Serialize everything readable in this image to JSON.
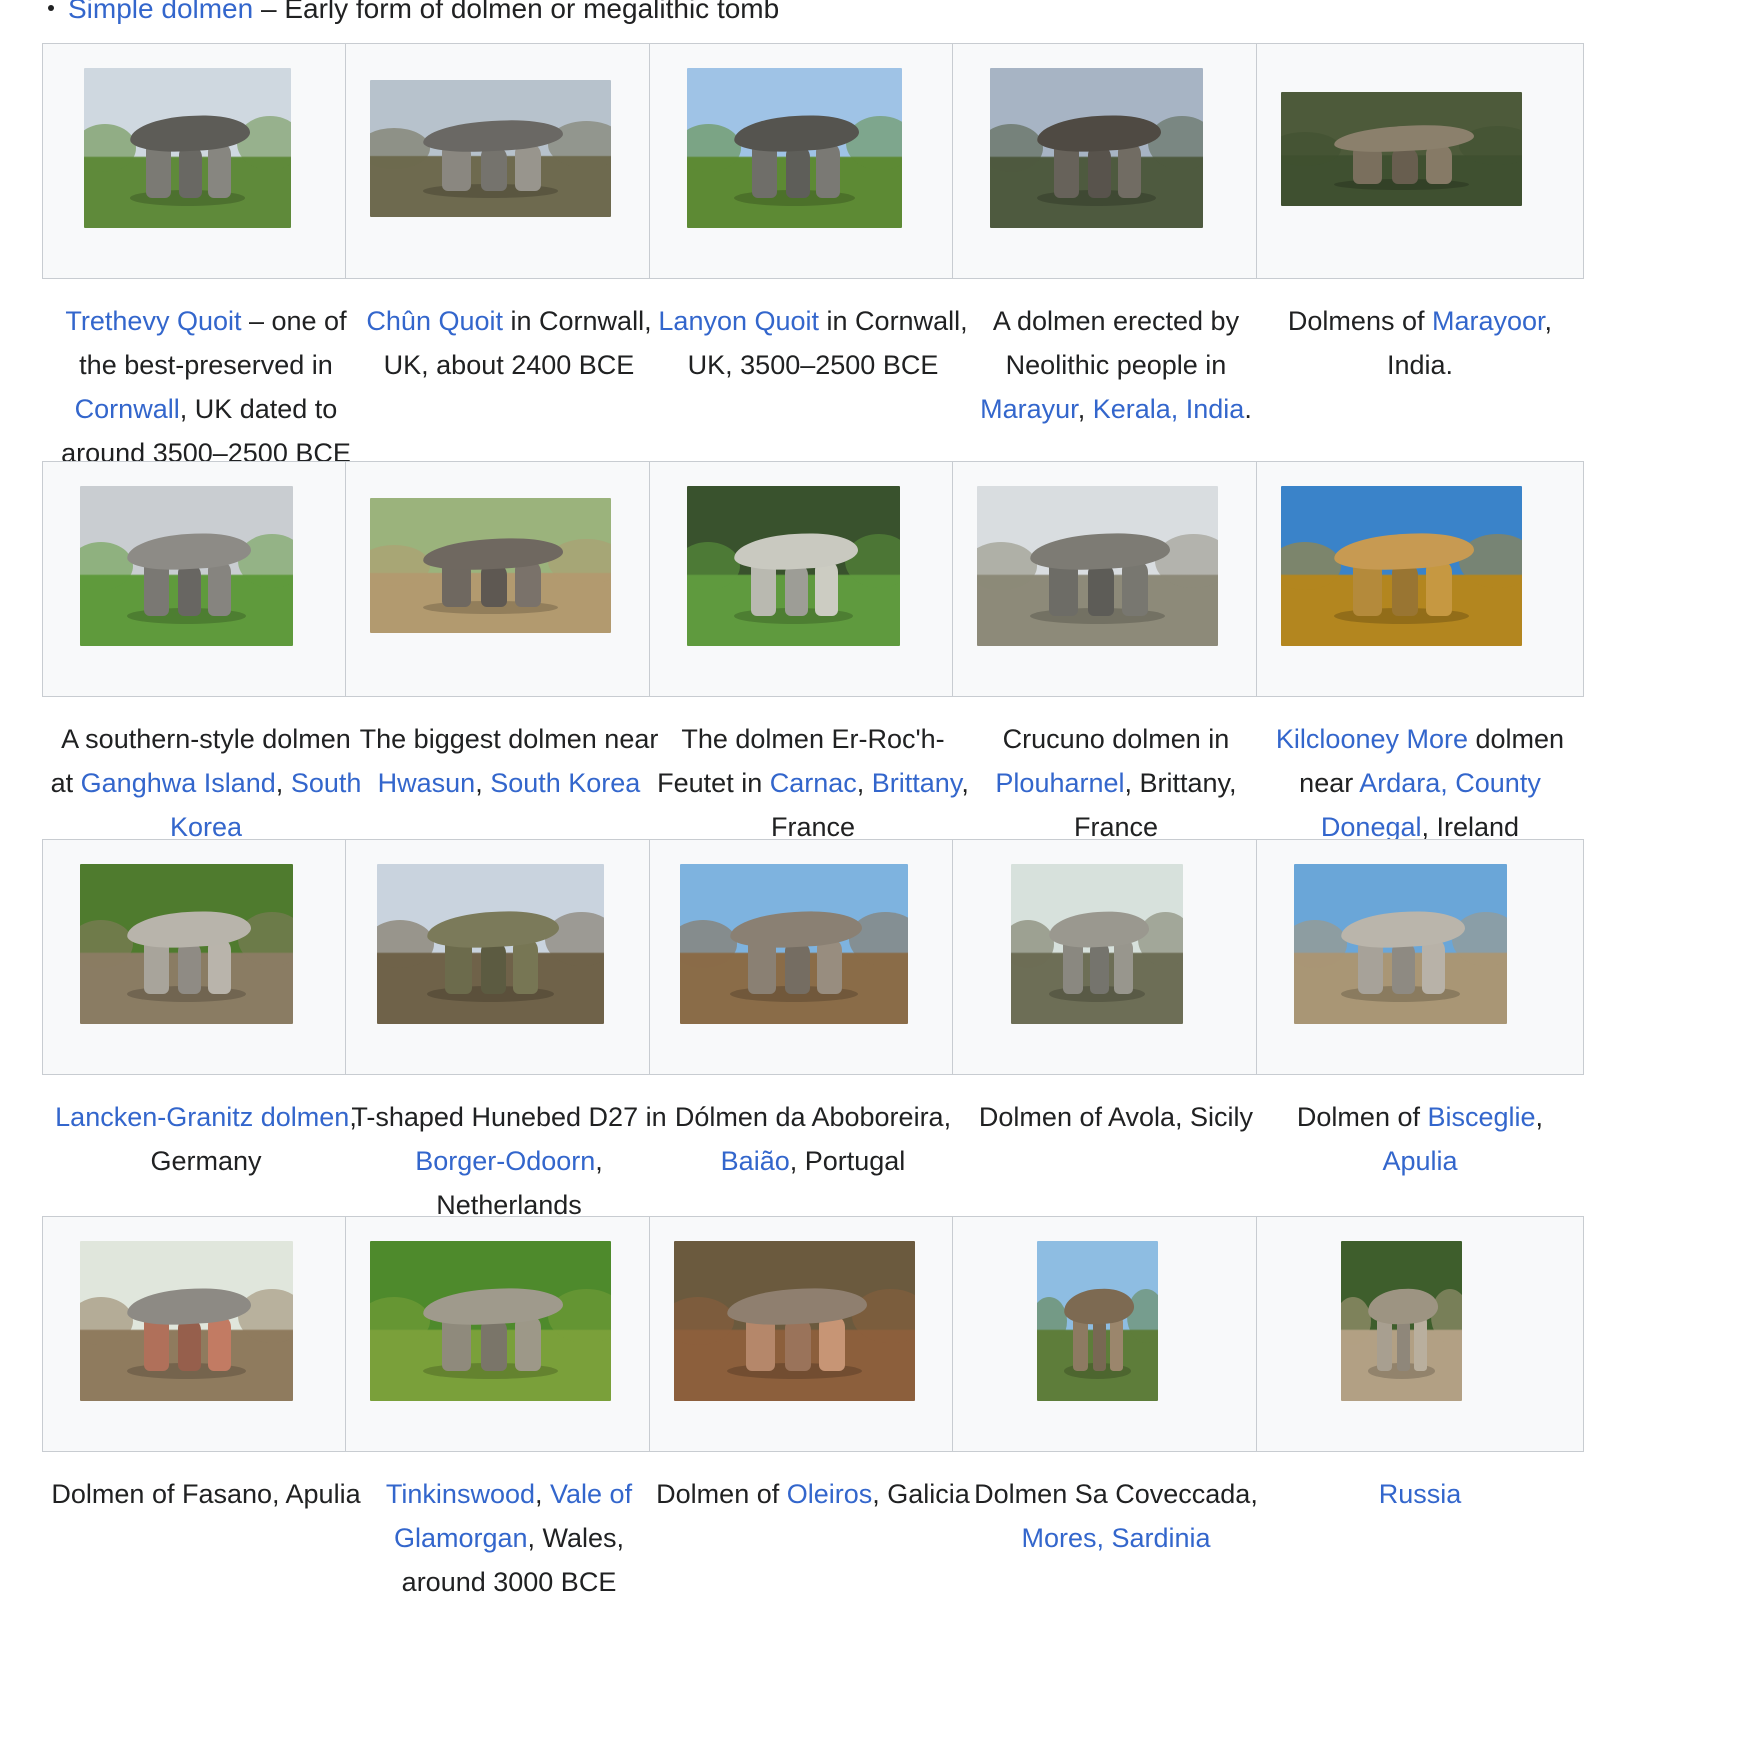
{
  "intro": {
    "link": "Simple dolmen",
    "text": " – Early form of dolmen or megalithic tomb"
  },
  "gallery": [
    {
      "caption": [
        [
          "Trethevy Quoit",
          true
        ],
        [
          " – one of",
          false
        ],
        [
          "\n",
          false
        ],
        [
          "the best-preserved in",
          false
        ],
        [
          "\n",
          false
        ],
        [
          "Cornwall",
          true
        ],
        [
          ", UK dated to",
          false
        ],
        [
          "\n",
          false
        ],
        [
          "around 3500–2500 BCE",
          false
        ]
      ]
    },
    {
      "caption": [
        [
          "Chûn Quoit",
          true
        ],
        [
          " in Cornwall,",
          false
        ],
        [
          "\n",
          false
        ],
        [
          "UK, about 2400 BCE",
          false
        ]
      ]
    },
    {
      "caption": [
        [
          "Lanyon Quoit",
          true
        ],
        [
          " in Cornwall,",
          false
        ],
        [
          "\n",
          false
        ],
        [
          "UK, 3500–2500 BCE",
          false
        ]
      ]
    },
    {
      "caption": [
        [
          "A dolmen erected by",
          false
        ],
        [
          "\n",
          false
        ],
        [
          "Neolithic people in",
          false
        ],
        [
          "\n",
          false
        ],
        [
          "Marayur",
          true
        ],
        [
          ", ",
          false
        ],
        [
          "Kerala, India",
          true
        ],
        [
          ".",
          false
        ]
      ]
    },
    {
      "caption": [
        [
          "Dolmens of ",
          false
        ],
        [
          "Marayoor",
          true
        ],
        [
          ",",
          false
        ],
        [
          "\n",
          false
        ],
        [
          "India.",
          false
        ]
      ]
    },
    {
      "caption": [
        [
          "A southern-style dolmen",
          false
        ],
        [
          "\n",
          false
        ],
        [
          "at ",
          false
        ],
        [
          "Ganghwa Island",
          true
        ],
        [
          ", ",
          false
        ],
        [
          "South",
          true
        ],
        [
          "\n",
          false
        ],
        [
          "Korea",
          true
        ]
      ]
    },
    {
      "caption": [
        [
          "The biggest dolmen near",
          false
        ],
        [
          "\n",
          false
        ],
        [
          "Hwasun",
          true
        ],
        [
          ", ",
          false
        ],
        [
          "South Korea",
          true
        ]
      ]
    },
    {
      "caption": [
        [
          "The dolmen Er-Roc'h-",
          false
        ],
        [
          "\n",
          false
        ],
        [
          "Feutet in ",
          false
        ],
        [
          "Carnac",
          true
        ],
        [
          ", ",
          false
        ],
        [
          "Brittany",
          true
        ],
        [
          ",",
          false
        ],
        [
          "\n",
          false
        ],
        [
          "France",
          false
        ]
      ]
    },
    {
      "caption": [
        [
          "Crucuno dolmen in",
          false
        ],
        [
          "\n",
          false
        ],
        [
          "Plouharnel",
          true
        ],
        [
          ", Brittany,",
          false
        ],
        [
          "\n",
          false
        ],
        [
          "France",
          false
        ]
      ]
    },
    {
      "caption": [
        [
          "Kilclooney More",
          true
        ],
        [
          " dolmen",
          false
        ],
        [
          "\n",
          false
        ],
        [
          "near ",
          false
        ],
        [
          "Ardara, County",
          true
        ],
        [
          "\n",
          false
        ],
        [
          "Donegal",
          true
        ],
        [
          ", Ireland",
          false
        ]
      ]
    },
    {
      "caption": [
        [
          "Lancken-Granitz dolmen",
          true
        ],
        [
          ",",
          false
        ],
        [
          "\n",
          false
        ],
        [
          "Germany",
          false
        ]
      ]
    },
    {
      "caption": [
        [
          "T-shaped Hunebed D27 in",
          false
        ],
        [
          "\n",
          false
        ],
        [
          "Borger-Odoorn",
          true
        ],
        [
          ",",
          false
        ],
        [
          "\n",
          false
        ],
        [
          "Netherlands",
          false
        ]
      ]
    },
    {
      "caption": [
        [
          "Dólmen da Aboboreira,",
          false
        ],
        [
          "\n",
          false
        ],
        [
          "Baião",
          true
        ],
        [
          ", Portugal",
          false
        ]
      ]
    },
    {
      "caption": [
        [
          "Dolmen of Avola, Sicily",
          false
        ]
      ]
    },
    {
      "caption": [
        [
          "Dolmen of ",
          false
        ],
        [
          "Bisceglie",
          true
        ],
        [
          ",",
          false
        ],
        [
          "\n",
          false
        ],
        [
          "Apulia",
          true
        ]
      ]
    },
    {
      "caption": [
        [
          "Dolmen of Fasano, Apulia",
          false
        ]
      ]
    },
    {
      "caption": [
        [
          "Tinkinswood",
          true
        ],
        [
          ", ",
          false
        ],
        [
          "Vale of",
          true
        ],
        [
          "\n",
          false
        ],
        [
          "Glamorgan",
          true
        ],
        [
          ", Wales,",
          false
        ],
        [
          "\n",
          false
        ],
        [
          "around 3000 BCE",
          false
        ]
      ]
    },
    {
      "caption": [
        [
          "Dolmen of ",
          false
        ],
        [
          "Oleiros",
          true
        ],
        [
          ", Galicia",
          false
        ]
      ]
    },
    {
      "caption": [
        [
          "Dolmen Sa Coveccada,",
          false
        ],
        [
          "\n",
          false
        ],
        [
          "Mores, Sardinia",
          true
        ]
      ]
    },
    {
      "caption": [
        [
          "Russia",
          true
        ]
      ]
    }
  ]
}
